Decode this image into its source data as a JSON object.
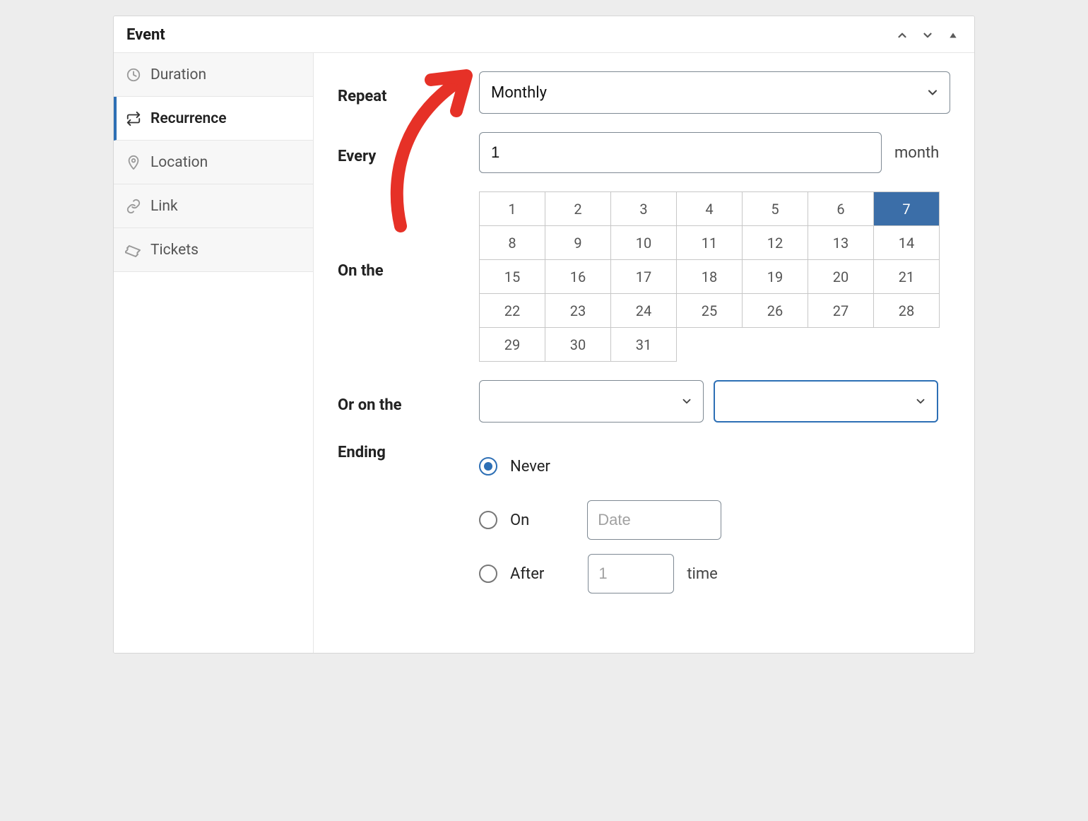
{
  "panel": {
    "title": "Event"
  },
  "sidebar": {
    "items": [
      {
        "label": "Duration"
      },
      {
        "label": "Recurrence"
      },
      {
        "label": "Location"
      },
      {
        "label": "Link"
      },
      {
        "label": "Tickets"
      }
    ],
    "active_index": 1
  },
  "form": {
    "repeat": {
      "label": "Repeat",
      "value": "Monthly"
    },
    "every": {
      "label": "Every",
      "value": "1",
      "unit": "month"
    },
    "on_the": {
      "label": "On the",
      "days": [
        1,
        2,
        3,
        4,
        5,
        6,
        7,
        8,
        9,
        10,
        11,
        12,
        13,
        14,
        15,
        16,
        17,
        18,
        19,
        20,
        21,
        22,
        23,
        24,
        25,
        26,
        27,
        28,
        29,
        30,
        31
      ],
      "selected": 7
    },
    "or_on_the": {
      "label": "Or on the",
      "value1": "",
      "value2": ""
    },
    "ending": {
      "label": "Ending",
      "options": [
        {
          "label": "Never",
          "checked": true
        },
        {
          "label": "On",
          "checked": false,
          "date_placeholder": "Date"
        },
        {
          "label": "After",
          "checked": false,
          "times_placeholder": "1",
          "times_unit": "time"
        }
      ]
    }
  },
  "colors": {
    "accent": "#2d6fb5",
    "day_selected_bg": "#3b6ea8"
  }
}
